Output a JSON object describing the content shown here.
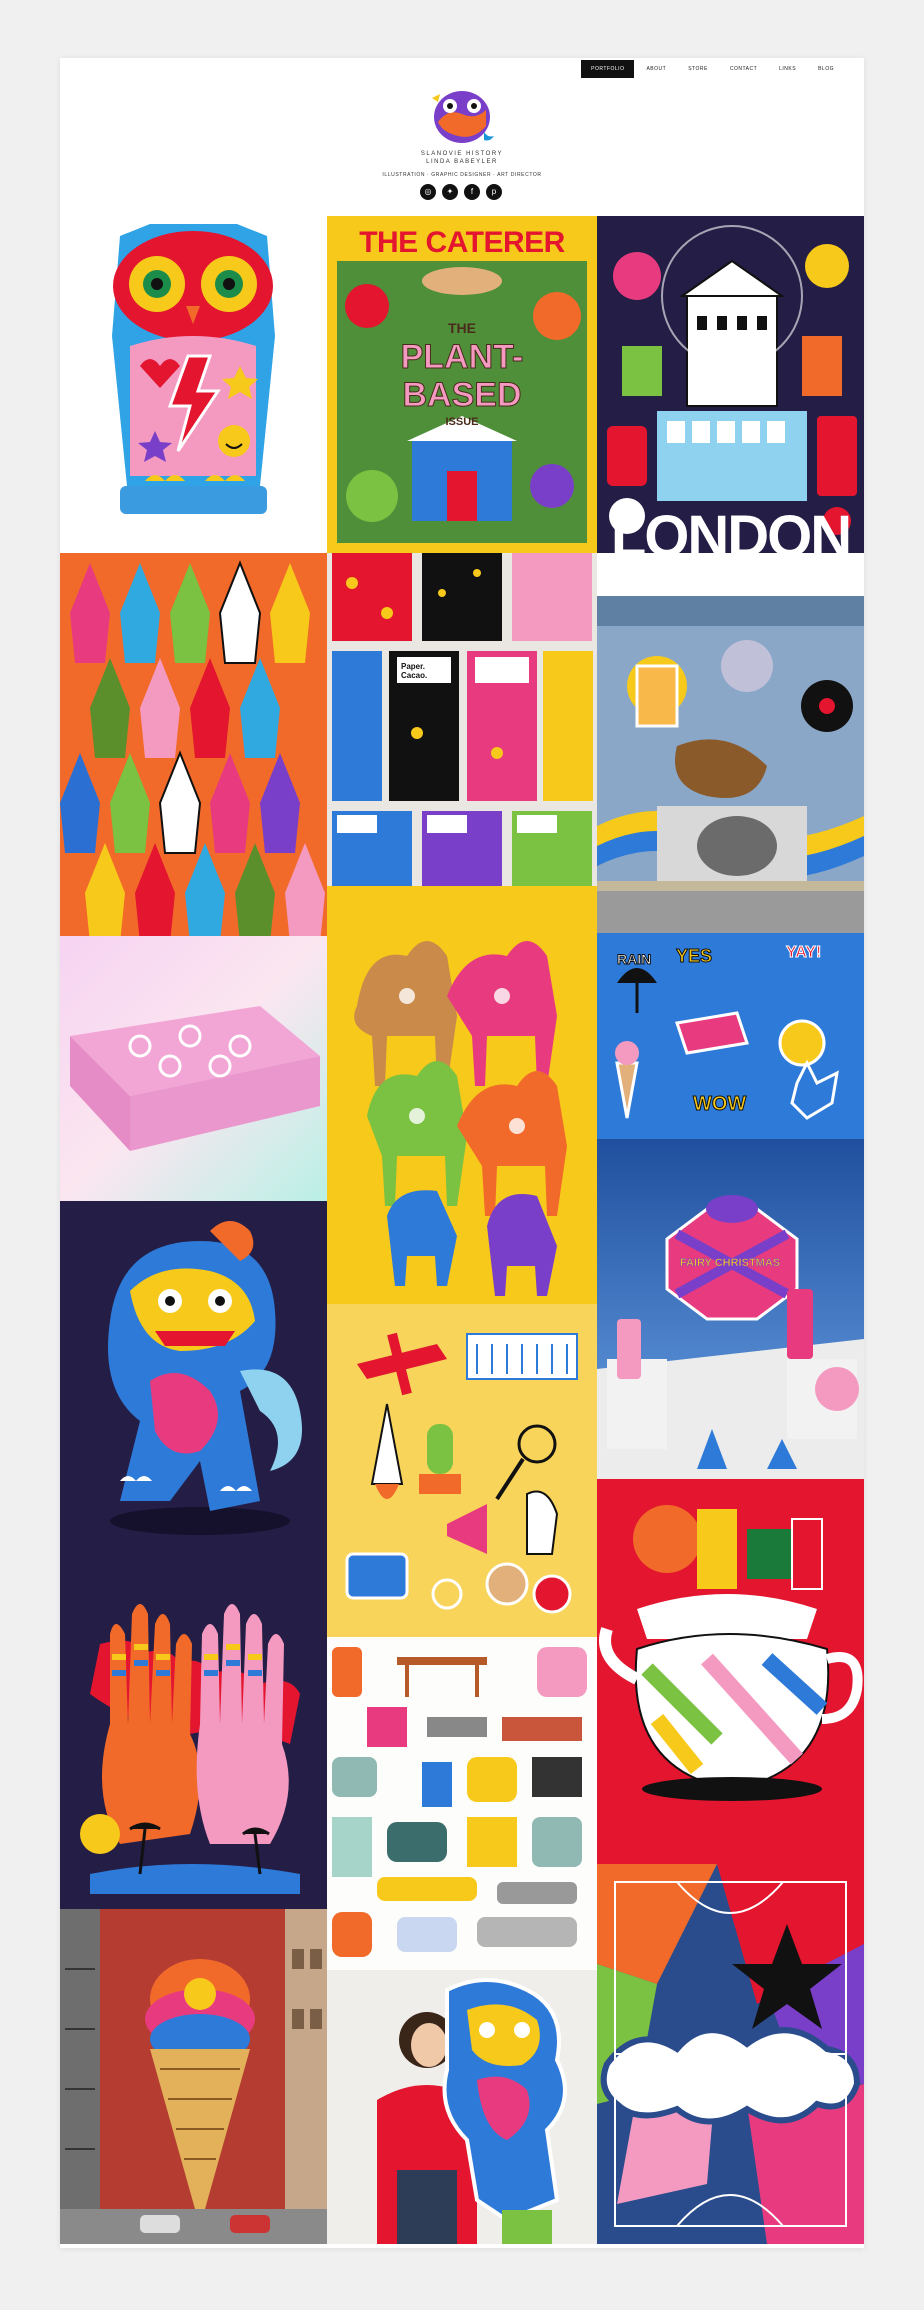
{
  "nav": {
    "items": [
      {
        "label": "PORTFOLIO",
        "active": true
      },
      {
        "label": "ABOUT"
      },
      {
        "label": "STORE"
      },
      {
        "label": "CONTACT"
      },
      {
        "label": "LINKS"
      },
      {
        "label": "BLOG"
      }
    ]
  },
  "header": {
    "studio": "SLANOVIE HISTORY",
    "person": "LINDA BABEYLER",
    "tagline": "ILLUSTRATION · GRAPHIC DESIGNER · ART DIRECTOR"
  },
  "social": {
    "icons": [
      "instagram-icon",
      "twitter-icon",
      "facebook-icon",
      "pinterest-icon"
    ]
  },
  "portfolio": {
    "caterer_title": "THE CATERER",
    "caterer_subtitle": "THE",
    "caterer_line1": "PLANT-",
    "caterer_line2": "BASED",
    "caterer_issue": "ISSUE",
    "london_label": "LONDON",
    "paper_cacao": "Paper. Cacao.",
    "stickers": [
      "YES",
      "YAY!",
      "RAIN",
      "WOW"
    ],
    "fairy_label": "FAIRY CHRISTMAS"
  },
  "colors": {
    "accent": "#111111",
    "yellow": "#f7c91a",
    "navy": "#241d45",
    "red": "#e3152f",
    "blue": "#2e7ad9"
  }
}
